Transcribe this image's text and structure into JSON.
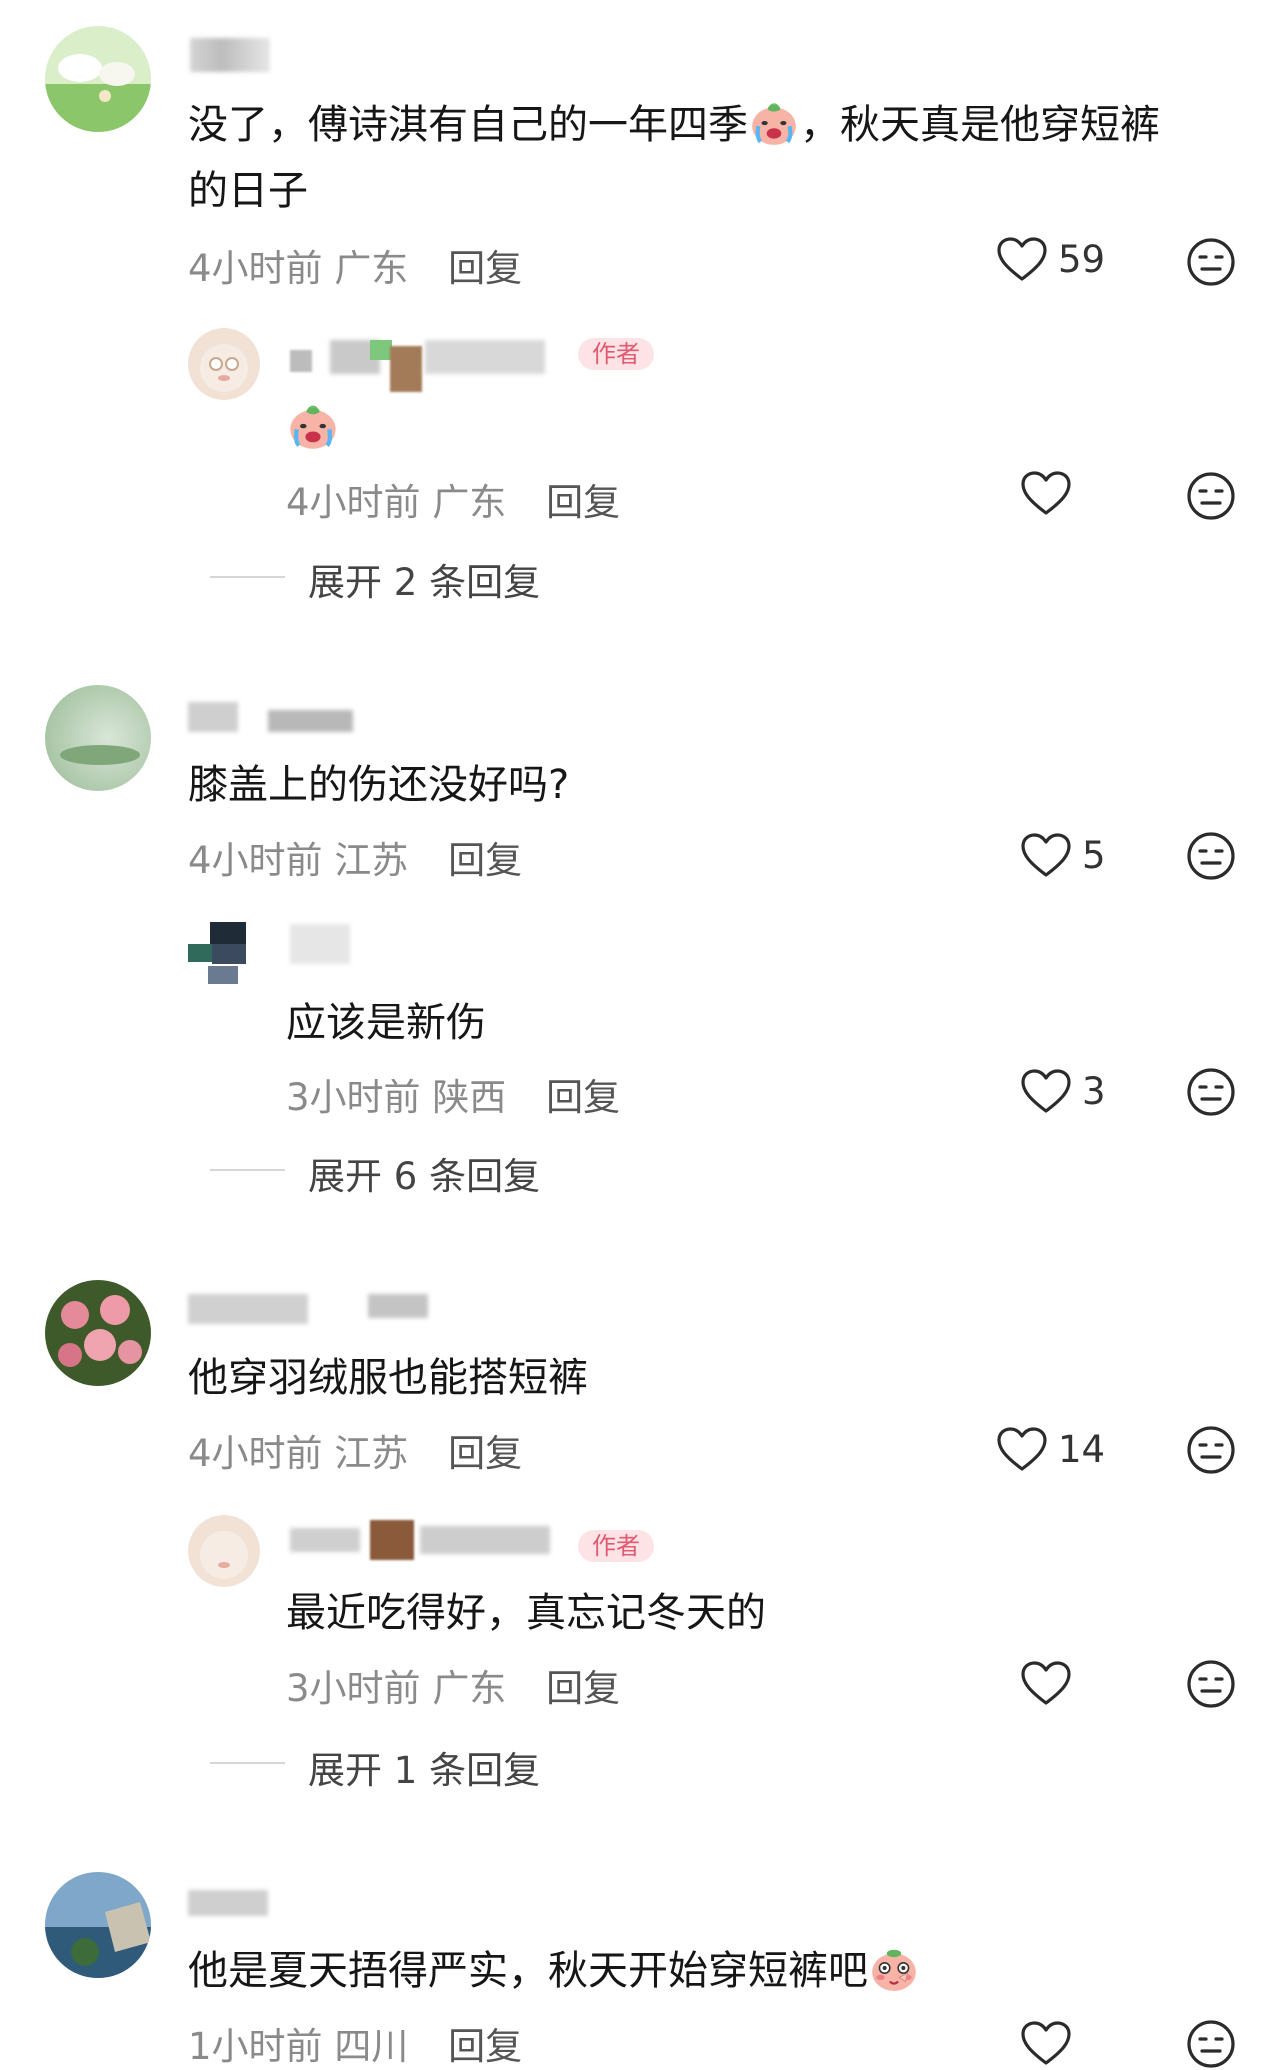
{
  "comments": [
    {
      "text_line1_a": "没了，傅诗淇有自己的一年四季",
      "text_line1_b": "，秋天真是他穿短裤",
      "text_line2": "的日子",
      "time": "4小时前",
      "location": "广东",
      "reply_label": "回复",
      "likes": "59",
      "replies": [
        {
          "tag": "作者",
          "time": "4小时前",
          "location": "广东",
          "reply_label": "回复",
          "likes": ""
        }
      ],
      "expand_label": "展开 2 条回复"
    },
    {
      "text": "膝盖上的伤还没好吗?",
      "time": "4小时前",
      "location": "江苏",
      "reply_label": "回复",
      "likes": "5",
      "replies": [
        {
          "text": "应该是新伤",
          "time": "3小时前",
          "location": "陕西",
          "reply_label": "回复",
          "likes": "3"
        }
      ],
      "expand_label": "展开 6 条回复"
    },
    {
      "text": "他穿羽绒服也能搭短裤",
      "time": "4小时前",
      "location": "江苏",
      "reply_label": "回复",
      "likes": "14",
      "replies": [
        {
          "tag": "作者",
          "text": "最近吃得好，真忘记冬天的",
          "time": "3小时前",
          "location": "广东",
          "reply_label": "回复",
          "likes": ""
        }
      ],
      "expand_label": "展开 1 条回复"
    },
    {
      "text": "他是夏天捂得严实，秋天开始穿短裤吧",
      "time": "1小时前",
      "location": "四川",
      "reply_label": "回复",
      "likes": ""
    }
  ],
  "icons": {
    "like": "heart-outline-icon",
    "dislike": "neutral-face-icon",
    "emoji_cry": "crying-face-sticker",
    "emoji_shy": "shy-face-sticker"
  },
  "colors": {
    "text": "#161616",
    "meta": "#8a8a8a",
    "author_tag_bg": "#fde3e6",
    "author_tag_text": "#e05a72"
  }
}
